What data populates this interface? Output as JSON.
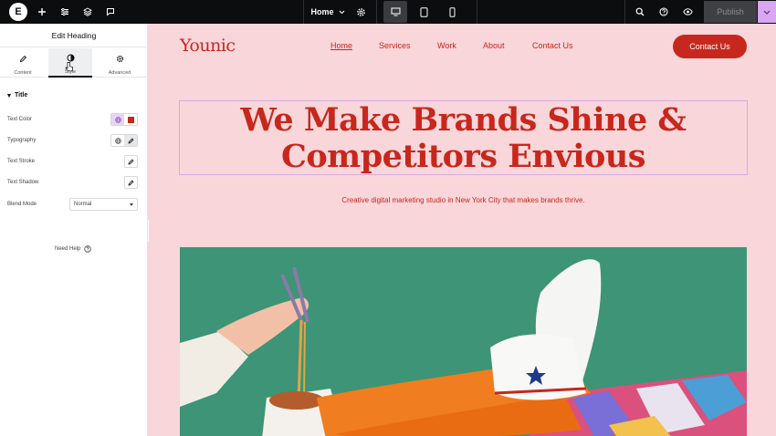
{
  "topbar": {
    "logo_glyph": "E",
    "page_name": "Home",
    "publish_label": "Publish",
    "icons": [
      "plus-icon",
      "sliders-icon",
      "layers-icon",
      "comment-icon",
      "gear-icon",
      "desktop-icon",
      "tablet-icon",
      "mobile-icon",
      "search-icon",
      "help-icon",
      "eye-icon",
      "chevron-down-icon"
    ]
  },
  "panel": {
    "title": "Edit Heading",
    "tabs": [
      {
        "label": "Content",
        "icon": "pencil-icon"
      },
      {
        "label": "Style",
        "icon": "half-circle-icon"
      },
      {
        "label": "Advanced",
        "icon": "gear-icon"
      }
    ],
    "section_title": "Title",
    "controls": {
      "text_color": "Text Color",
      "typography": "Typography",
      "text_stroke": "Text Stroke",
      "text_shadow": "Text Shadow",
      "blend_mode": "Blend Mode"
    },
    "blend_mode_value": "Normal",
    "need_help": "Need Help"
  },
  "site": {
    "logo": "Younic",
    "nav": [
      "Home",
      "Services",
      "Work",
      "About",
      "Contact Us"
    ],
    "cta": "Contact Us",
    "hero_title_line1": "We Make Brands Shine &",
    "hero_title_line2": "Competitors Envious",
    "hero_subtitle": "Creative digital marketing studio in New York City that makes brands thrive."
  },
  "colors": {
    "brand_red": "#c7271c",
    "canvas_pink": "#f9d6da",
    "topbar_dark": "#0c0d0e",
    "accent_purple": "#d9a6f2",
    "hero_green": "#3d9476",
    "sock_orange": "#f07d1f"
  }
}
